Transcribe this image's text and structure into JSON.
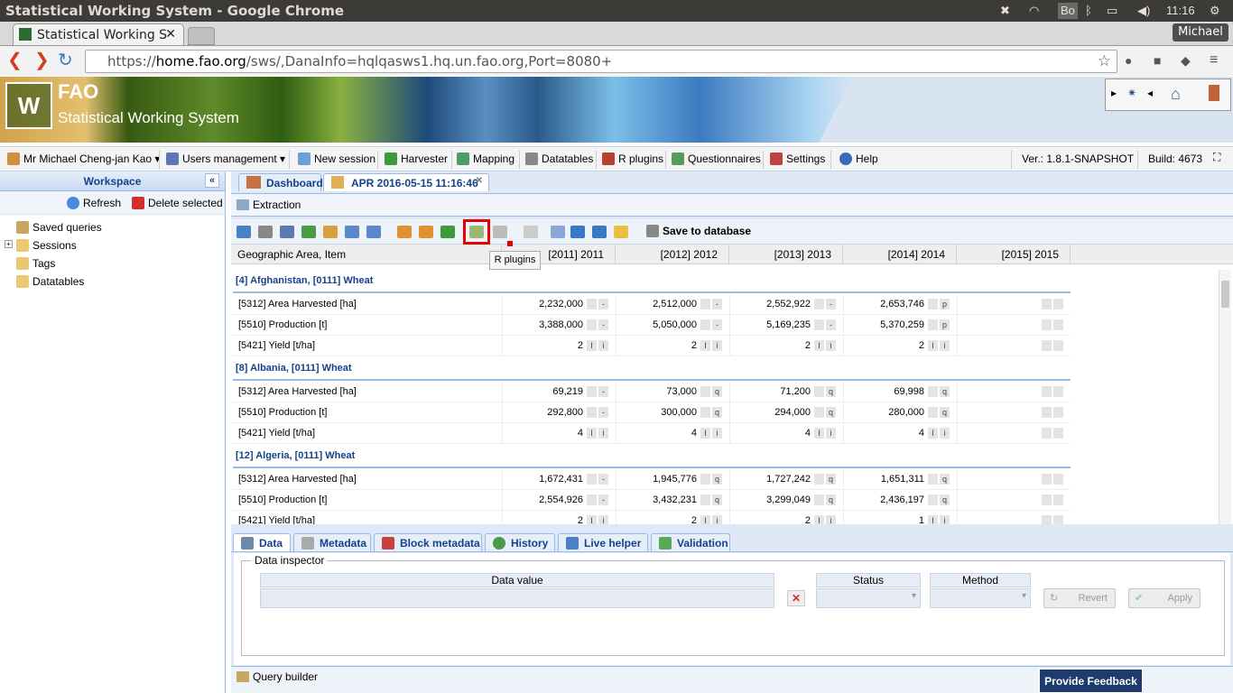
{
  "os": {
    "window_title": "Statistical Working System - Google Chrome",
    "time": "11:16",
    "keyboard": "Bo"
  },
  "browser": {
    "tab_title": "Statistical Working S",
    "user": "Michael",
    "url_scheme": "https://",
    "url_host": "home.fao.org",
    "url_path": "/sws/,DanaInfo=hqlqasws1.hq.un.fao.org,Port=8080+"
  },
  "banner": {
    "fao": "FAO",
    "system": "Statistical Working System"
  },
  "menu": {
    "user": "Mr Michael Cheng-jan Kao",
    "items": [
      "Users management",
      "New session",
      "Harvester",
      "Mapping",
      "Datatables",
      "R plugins",
      "Questionnaires",
      "Settings",
      "Help"
    ],
    "version": "Ver.: 1.8.1-SNAPSHOT",
    "build": "Build: 4673"
  },
  "workspace": {
    "title": "Workspace",
    "refresh": "Refresh",
    "delete": "Delete selected",
    "tree": [
      "Saved queries",
      "Sessions",
      "Tags",
      "Datatables"
    ]
  },
  "tabs": {
    "dashboard": "Dashboard",
    "session": "APR 2016-05-15 11:16:46"
  },
  "extraction": "Extraction",
  "toolbar": {
    "save": "Save to database",
    "tooltip": "R plugins"
  },
  "grid": {
    "header": [
      "Geographic Area, Item",
      "[2011] 2011",
      "[2012] 2012",
      "[2013] 2013",
      "[2014] 2014",
      "[2015] 2015"
    ],
    "groups": [
      {
        "title": "[4] Afghanistan, [0111] Wheat",
        "rows": [
          {
            "label": "[5312] Area Harvested [ha]",
            "values": [
              "2,232,000",
              "2,512,000",
              "2,552,922",
              "2,653,746",
              ""
            ],
            "flags": [
              [
                "",
                "-"
              ],
              [
                "",
                "-"
              ],
              [
                "",
                "-"
              ],
              [
                "",
                "p"
              ],
              [
                "",
                ""
              ]
            ]
          },
          {
            "label": "[5510] Production [t]",
            "values": [
              "3,388,000",
              "5,050,000",
              "5,169,235",
              "5,370,259",
              ""
            ],
            "flags": [
              [
                "",
                "-"
              ],
              [
                "",
                "-"
              ],
              [
                "",
                "-"
              ],
              [
                "",
                "p"
              ],
              [
                "",
                ""
              ]
            ]
          },
          {
            "label": "[5421] Yield [t/ha]",
            "values": [
              "2",
              "2",
              "2",
              "2",
              ""
            ],
            "flags": [
              [
                "I",
                "i"
              ],
              [
                "I",
                "i"
              ],
              [
                "I",
                "i"
              ],
              [
                "I",
                "i"
              ],
              [
                "",
                ""
              ]
            ]
          }
        ]
      },
      {
        "title": "[8] Albania, [0111] Wheat",
        "rows": [
          {
            "label": "[5312] Area Harvested [ha]",
            "values": [
              "69,219",
              "73,000",
              "71,200",
              "69,998",
              ""
            ],
            "flags": [
              [
                "",
                "-"
              ],
              [
                "",
                "q"
              ],
              [
                "",
                "q"
              ],
              [
                "",
                "q"
              ],
              [
                "",
                ""
              ]
            ]
          },
          {
            "label": "[5510] Production [t]",
            "values": [
              "292,800",
              "300,000",
              "294,000",
              "280,000",
              ""
            ],
            "flags": [
              [
                "",
                "-"
              ],
              [
                "",
                "q"
              ],
              [
                "",
                "q"
              ],
              [
                "",
                "q"
              ],
              [
                "",
                ""
              ]
            ]
          },
          {
            "label": "[5421] Yield [t/ha]",
            "values": [
              "4",
              "4",
              "4",
              "4",
              ""
            ],
            "flags": [
              [
                "I",
                "i"
              ],
              [
                "I",
                "i"
              ],
              [
                "I",
                "i"
              ],
              [
                "I",
                "i"
              ],
              [
                "",
                ""
              ]
            ]
          }
        ]
      },
      {
        "title": "[12] Algeria, [0111] Wheat",
        "rows": [
          {
            "label": "[5312] Area Harvested [ha]",
            "values": [
              "1,672,431",
              "1,945,776",
              "1,727,242",
              "1,651,311",
              ""
            ],
            "flags": [
              [
                "",
                "-"
              ],
              [
                "",
                "q"
              ],
              [
                "",
                "q"
              ],
              [
                "",
                "q"
              ],
              [
                "",
                ""
              ]
            ]
          },
          {
            "label": "[5510] Production [t]",
            "values": [
              "2,554,926",
              "3,432,231",
              "3,299,049",
              "2,436,197",
              ""
            ],
            "flags": [
              [
                "",
                "-"
              ],
              [
                "",
                "q"
              ],
              [
                "",
                "q"
              ],
              [
                "",
                "q"
              ],
              [
                "",
                ""
              ]
            ]
          },
          {
            "label": "[5421] Yield [t/ha]",
            "values": [
              "2",
              "2",
              "2",
              "1",
              ""
            ],
            "flags": [
              [
                "I",
                "i"
              ],
              [
                "I",
                "i"
              ],
              [
                "I",
                "i"
              ],
              [
                "I",
                "i"
              ],
              [
                "",
                ""
              ]
            ]
          }
        ]
      }
    ]
  },
  "bottom_tabs": [
    "Data",
    "Metadata",
    "Block metadata",
    "History",
    "Live helper",
    "Validation"
  ],
  "inspector": {
    "legend": "Data inspector",
    "data_value": "Data value",
    "status": "Status",
    "method": "Method",
    "revert": "Revert",
    "apply": "Apply"
  },
  "query_builder": "Query builder",
  "feedback": "Provide Feedback"
}
